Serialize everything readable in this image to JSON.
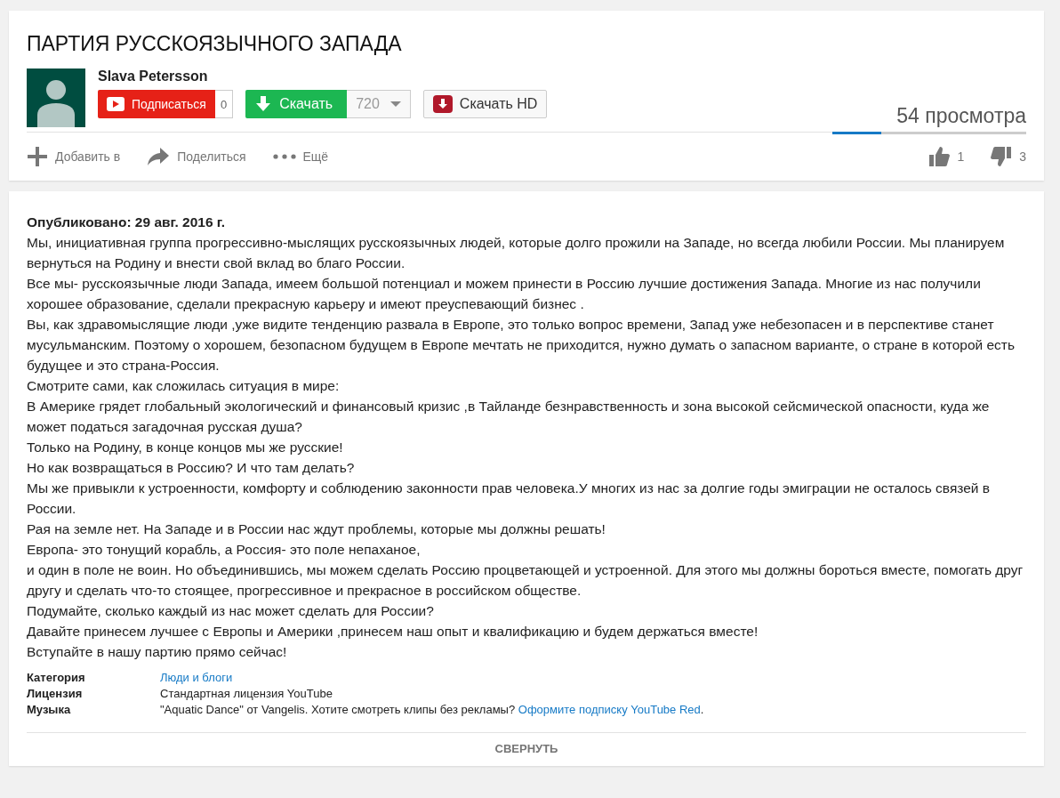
{
  "video": {
    "title": "ПАРТИЯ РУССКОЯЗЫЧНОГО ЗАПАДА",
    "channel": "Slava Petersson",
    "subscribe": {
      "label": "Подписаться",
      "count": "0"
    },
    "download": {
      "label": "Скачать",
      "quality": "720"
    },
    "download_hd": {
      "label": "Скачать HD"
    },
    "views": "54 просмотра",
    "sentiment": {
      "level": 0.25
    },
    "actions": [
      {
        "kind": "add",
        "label": "Добавить в"
      },
      {
        "kind": "share",
        "label": "Поделиться"
      },
      {
        "kind": "more",
        "label": "Ещё"
      }
    ],
    "likes": "1",
    "dislikes": "3"
  },
  "description": {
    "published": "Опубликовано: 29 авг. 2016 г.",
    "paragraphs": [
      "Мы, инициативная группа прогрессивно-мыслящих русскоязычных людей, которые долго прожили на Западе, но всегда любили России. Мы планируем вернуться на Родину и внести свой вклад во благо России.",
      "Все мы- русскоязычные люди Запада, имеем большой потенциал и можем принести в Россию лучшие достижения Запада. Многие из нас получили хорошее образование, сделали прекрасную карьеру и имеют преуспевающий бизнес .",
      "Вы, как здравомыслящие люди ,уже видите тенденцию развала в Европе, это только вопрос времени, Запад уже небезопасен и в перспективе станет мусульманским. Поэтому о хорошем, безопасном будущем в Европе мечтать не приходится, нужно думать о запасном варианте, о стране в которой есть будущее и это страна-Россия.",
      "Смотрите сами, как сложилась ситуация в мире:",
      "В Америке грядет глобальный экологический и финансовый кризис ,в Тайланде безнравственность и зона высокой сейсмической опасности, куда же может податься загадочная русская душа?",
      "Только на Родину, в конце концов мы же русские!",
      "Но как возвращаться в Россию? И что там делать?",
      "Мы же привыкли к устроенности, комфорту и соблюдению законности прав человека.У многих из нас за долгие годы эмиграции не осталось связей в России.",
      "Рая на земле нет. На Западе и в России нас ждут проблемы, которые мы должны решать!",
      "Европа- это тонущий корабль, а Россия- это поле непаханое,",
      "и один в поле не воин. Но объединившись, мы можем сделать Россию процветающей и устроенной. Для этого мы должны бороться вместе, помогать друг другу и сделать что-то стоящее, прогрессивное и прекрасное в российском обществе.",
      "Подумайте, сколько каждый из нас может сделать для России?",
      "Давайте принесем лучшее с Европы и Америки ,принесем наш опыт и квалификацию и будем держаться вместе!",
      "Вступайте в нашу партию прямо сейчас!"
    ],
    "meta": [
      {
        "label": "Категория",
        "link": "Люди и блоги"
      },
      {
        "label": "Лицензия",
        "value": "Стандартная лицензия YouTube"
      },
      {
        "label": "Музыка",
        "value": "\"Aquatic Dance\" от Vangelis. Хотите смотреть клипы без рекламы?",
        "link": "Оформите подписку YouTube Red",
        "after": "."
      }
    ],
    "collapse": "СВЕРНУТЬ"
  }
}
